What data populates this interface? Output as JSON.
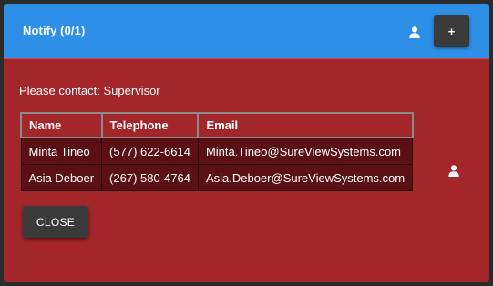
{
  "header": {
    "title": "Notify (0/1)",
    "add_label": "+",
    "user_icon": "user-icon"
  },
  "contact": {
    "label": "Please contact: Supervisor"
  },
  "table": {
    "columns": [
      "Name",
      "Telephone",
      "Email"
    ],
    "rows": [
      {
        "name": "Minta Tineo",
        "telephone": "(577) 622-6614",
        "email": "Minta.Tineo@SureViewSystems.com"
      },
      {
        "name": "Asia Deboer",
        "telephone": "(267) 580-4764",
        "email": "Asia.Deboer@SureViewSystems.com"
      }
    ]
  },
  "footer": {
    "close_label": "CLOSE"
  },
  "colors": {
    "header_bg": "#2d8fe6",
    "body_bg": "#a3262b",
    "row_bg": "#5b1114",
    "button_bg": "#3a3a3a"
  }
}
